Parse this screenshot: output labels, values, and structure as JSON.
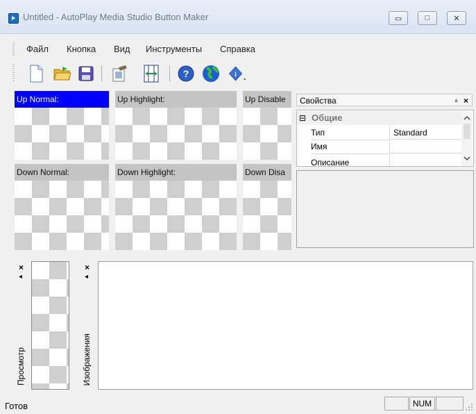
{
  "window": {
    "title": "Untitled - AutoPlay Media Studio Button Maker"
  },
  "caption_buttons": {
    "minimize": "▭",
    "maximize": "□",
    "close": "✕"
  },
  "menu": [
    "Файл",
    "Кнопка",
    "Вид",
    "Инструменты",
    "Справка"
  ],
  "toolbar": {
    "icons": [
      "new-file-icon",
      "open-folder-icon",
      "save-icon",
      "edit-image-icon",
      "resize-icon",
      "help-icon",
      "web-globe-icon",
      "info-dropdown-icon"
    ]
  },
  "states": {
    "up_normal": "Up Normal:",
    "up_highlight": "Up Highlight:",
    "up_disabled": "Up Disable",
    "down_normal": "Down Normal:",
    "down_highlight": "Down Highlight:",
    "down_disabled": "Down Disa"
  },
  "properties": {
    "title": "Свойства",
    "pin": "▴",
    "close": "×",
    "category": "Общие",
    "collapse": "⊟",
    "rows": [
      {
        "name": "Тип",
        "value": "Standard"
      },
      {
        "name": "Имя",
        "value": ""
      },
      {
        "name": "Описание",
        "value": ""
      }
    ]
  },
  "panes": {
    "preview": "Просмотр",
    "images": "Изображения",
    "close": "×",
    "arrow": "◂"
  },
  "status": {
    "text": "Готов",
    "num": "NUM"
  }
}
